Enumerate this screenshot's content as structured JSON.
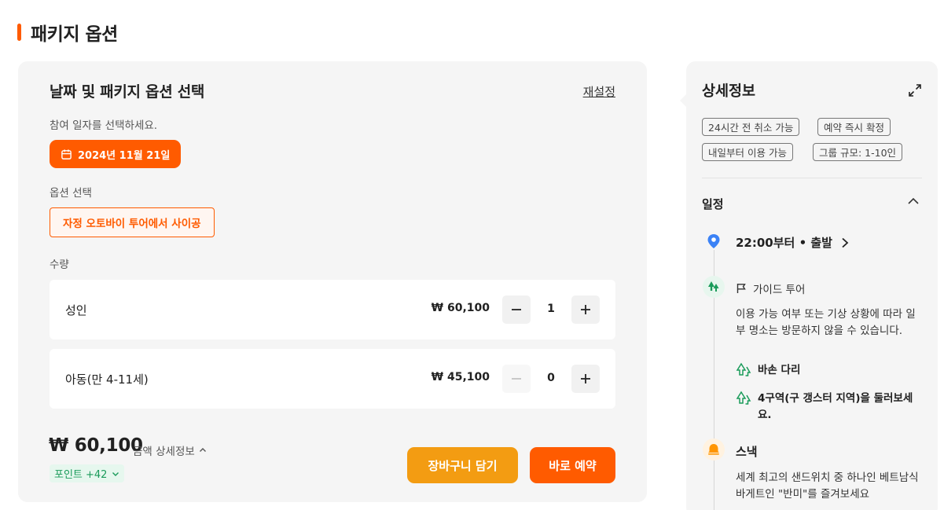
{
  "page": {
    "title": "패키지 옵션"
  },
  "booking": {
    "heading": "날짜 및 패키지 옵션 선택",
    "reset_label": "재설정",
    "date_prompt": "참여 일자를 선택하세요.",
    "selected_date": "2024년 11월 21일",
    "option_label": "옵션 선택",
    "selected_option": "자정 오토바이 투어에서 사이공",
    "quantity_label": "수량",
    "rows": [
      {
        "name": "성인",
        "price": "₩ 60,100",
        "qty": "1"
      },
      {
        "name": "아동(만 4-11세)",
        "price": "₩ 45,100",
        "qty": "0"
      }
    ],
    "total": "₩ 60,100",
    "price_detail_label": "금액 상세정보",
    "points_label": "포인트 +42",
    "cart_button": "장바구니 담기",
    "book_button": "바로 예약"
  },
  "details": {
    "heading": "상세정보",
    "tags": [
      "24시간 전 취소 가능",
      "예약 즉시 확정",
      "내일부터 이용 가능",
      "그룹 규모: 1-10인"
    ],
    "schedule_label": "일정",
    "start": "22:00부터 • 출발",
    "guide_label": "가이드 투어",
    "guide_note": "이용 가능 여부 또는 기상 상황에 따라 일부 명소는 방문하지 않을 수 있습니다.",
    "stops": [
      "바손 다리",
      "4구역(구 갱스터 지역)을 둘러보세요."
    ],
    "snack_label": "스낵",
    "snack_note": "세계 최고의 샌드위치 중 하나인 베트남식 바게트인 \"반미\"를 즐겨보세요"
  },
  "colors": {
    "accent": "#ff5b00",
    "cart": "#f39c12",
    "points": "#1a9b5a",
    "pin": "#3b82f6",
    "snack": "#ff9500"
  },
  "icons": [
    "calendar-icon",
    "chevron-up-icon",
    "chevron-down-icon",
    "minus-icon",
    "plus-icon",
    "expand-icon",
    "location-pin-icon",
    "chevron-right-icon",
    "trees-icon",
    "flag-icon",
    "bell-icon"
  ]
}
